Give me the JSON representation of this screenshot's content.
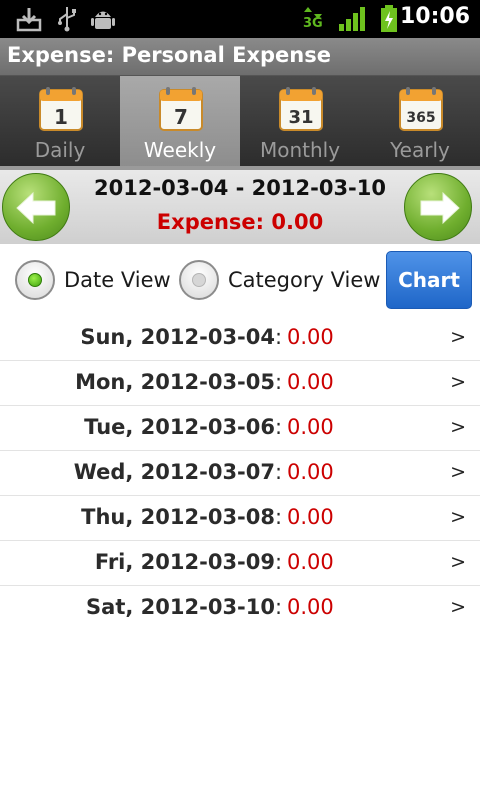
{
  "status_bar": {
    "time": "10:06",
    "network": "3G",
    "icons": [
      "download-icon",
      "usb-icon",
      "android-debug-icon",
      "network-3g-icon",
      "signal-icon",
      "battery-charging-icon"
    ]
  },
  "title": "Expense: Personal Expense",
  "tabs": [
    {
      "label": "Daily",
      "calendar_number": "1"
    },
    {
      "label": "Weekly",
      "calendar_number": "7"
    },
    {
      "label": "Monthly",
      "calendar_number": "31"
    },
    {
      "label": "Yearly",
      "calendar_number": "365"
    }
  ],
  "active_tab": "Weekly",
  "period": {
    "range": "2012-03-04 - 2012-03-10",
    "expense": "Expense: 0.00"
  },
  "view_options": {
    "date_view": "Date View",
    "category_view": "Category View",
    "selected": "Date View",
    "chart_button": "Chart"
  },
  "days": [
    {
      "label": "Sun, 2012-03-04",
      "amount": "0.00"
    },
    {
      "label": "Mon, 2012-03-05",
      "amount": "0.00"
    },
    {
      "label": "Tue, 2012-03-06",
      "amount": "0.00"
    },
    {
      "label": "Wed, 2012-03-07",
      "amount": "0.00"
    },
    {
      "label": "Thu, 2012-03-08",
      "amount": "0.00"
    },
    {
      "label": "Fri, 2012-03-09",
      "amount": "0.00"
    },
    {
      "label": "Sat, 2012-03-10",
      "amount": "0.00"
    }
  ],
  "row_separator": ":",
  "row_chevron": ">",
  "colors": {
    "expense_red": "#cc0000",
    "accent_green": "#6fae2e",
    "chart_blue": "#1f66c8"
  }
}
